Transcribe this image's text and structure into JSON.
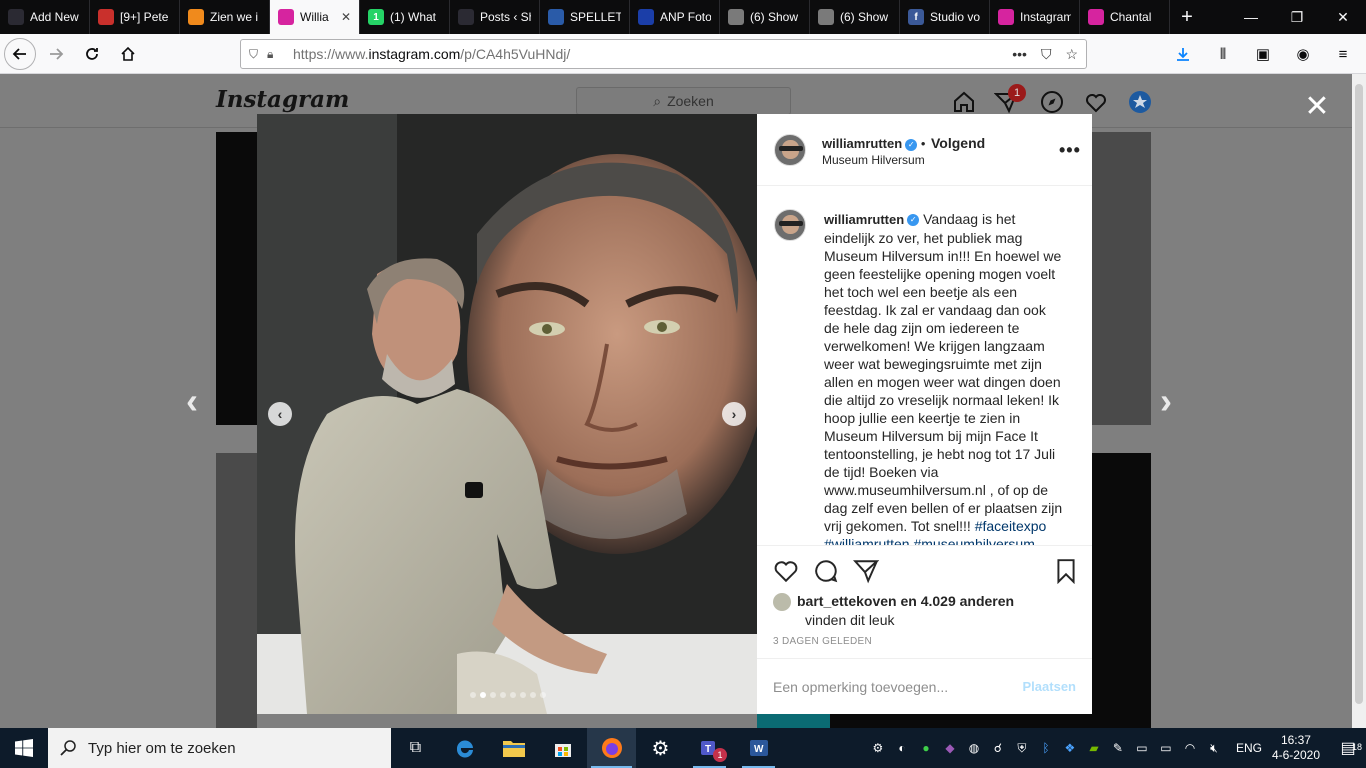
{
  "browser": {
    "tabs": [
      {
        "label": "Add New Po",
        "color": "#2b2a33",
        "glyph": "",
        "active": false
      },
      {
        "label": "[9+] Pete",
        "color": "#c9302c",
        "glyph": "",
        "active": false
      },
      {
        "label": "Zien we i",
        "color": "#f08a1c",
        "glyph": "",
        "active": false
      },
      {
        "label": "Willia",
        "color": "#d6249f",
        "glyph": "",
        "active": true
      },
      {
        "label": "(1) What",
        "color": "#25d366",
        "glyph": "1",
        "active": false
      },
      {
        "label": "Posts ‹ Show",
        "color": "#2b2a33",
        "glyph": "",
        "active": false
      },
      {
        "label": "SPELLET",
        "color": "#2a5ba8",
        "glyph": "",
        "active": false
      },
      {
        "label": "ANP Foto",
        "color": "#1b3ea8",
        "glyph": "",
        "active": false
      },
      {
        "label": "(6) Show",
        "color": "#7a7a7a",
        "glyph": "",
        "active": false
      },
      {
        "label": "(6) Show",
        "color": "#7a7a7a",
        "glyph": "",
        "active": false
      },
      {
        "label": "Studio vo",
        "color": "#3b5998",
        "glyph": "f",
        "active": false
      },
      {
        "label": "Instagram",
        "color": "#d6249f",
        "glyph": "",
        "active": false
      },
      {
        "label": "Chantal",
        "color": "#d6249f",
        "glyph": "",
        "active": false
      }
    ],
    "url": {
      "prefix": "https://www.",
      "domain": "instagram.com",
      "path": "/p/CA4h5VuHNdj/"
    }
  },
  "instagram": {
    "logo": "Instagram",
    "search_placeholder": "Zoeken",
    "notification_count": "1"
  },
  "post": {
    "username": "williamrutten",
    "follow_status": "Volgend",
    "location": "Museum Hilversum",
    "caption_text": "Vandaag is het eindelijk zo ver, het publiek mag Museum Hilversum in!!! En hoewel we geen feestelijke opening mogen voelt het toch wel een beetje als een feestdag. Ik zal er vandaag dan ook de hele dag zijn om iedereen te verwelkomen! We krijgen langzaam weer wat bewegingsruimte met zijn allen en mogen weer wat dingen doen die altijd zo vreselijk normaal leken! Ik hoop jullie een keertje te zien in Museum Hilversum bij mijn Face It tentoonstelling, je hebt nog tot 17 Juli de tijd! Boeken via www.museumhilversum.nl , of op de dag zelf even bellen of er plaatsen zijn vrij gekomen. Tot snel!!!",
    "hashtags": [
      "#faceitexpo",
      "#williamrutten",
      "#museumhilversum"
    ],
    "liked_by_user": "bart_ettekoven",
    "liked_by_rest": "en 4.029 anderen",
    "liked_suffix": "vinden dit leuk",
    "time_ago": "3 DAGEN GELEDEN",
    "comment_placeholder": "Een opmerking toevoegen...",
    "post_button": "Plaatsen",
    "carousel_count": 8,
    "carousel_index": 1
  },
  "taskbar": {
    "search_placeholder": "Typ hier om te zoeken",
    "language": "ENG",
    "time": "16:37",
    "date": "4-6-2020",
    "notification_count": "18",
    "teams_badge": "1"
  },
  "colors": {
    "instagram_blue": "#3897f0",
    "instagram_hashtag": "#00376b",
    "firefox_accent": "#0a84ff",
    "taskbar_bg": "#0d1b2a"
  }
}
